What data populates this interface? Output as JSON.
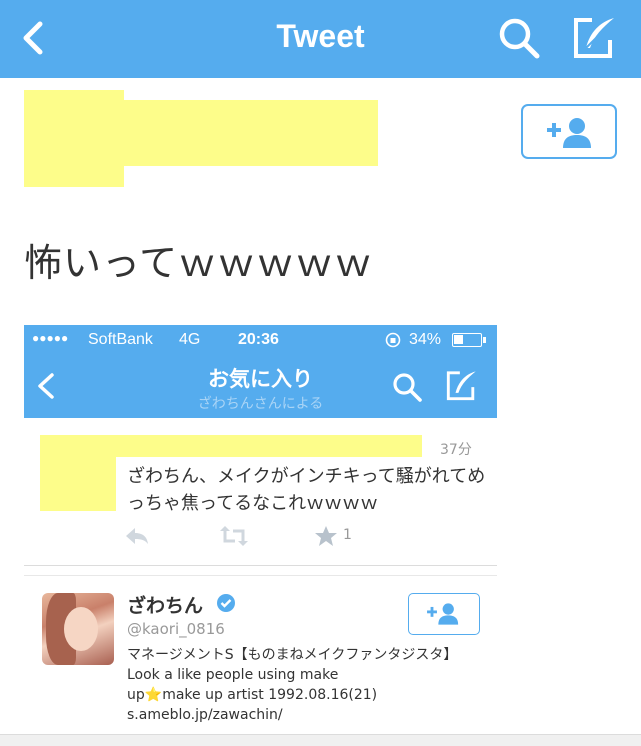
{
  "header": {
    "title": "Tweet",
    "back_icon": "chevron-left-icon",
    "search_icon": "search-icon",
    "compose_icon": "compose-icon"
  },
  "tweet": {
    "text": "怖いってｗｗｗｗｗ",
    "follow_icon": "add-user-icon"
  },
  "embedded": {
    "status_bar": {
      "signal": "●●●●●",
      "carrier": "SoftBank",
      "network": "4G",
      "time": "20:36",
      "battery": "34%"
    },
    "nav": {
      "title": "お気に入り",
      "subtitle": "ざわちんさんによる"
    },
    "tweet": {
      "time": "37分",
      "text": "ざわちん、メイクがインチキって騒がれてめっちゃ焦ってるなこれｗｗｗｗ",
      "favorite_count": "1"
    },
    "profile": {
      "name": "ざわちん",
      "handle": "@kaori_0816",
      "bio_line1": "マネージメントS【ものまねメイクファンタジスタ】 Look a like people using make",
      "bio_line2": "up⭐make up artist 1992.08.16(21)",
      "bio_line3": "s.ameblo.jp/zawachin/"
    }
  },
  "colors": {
    "accent": "#55acee",
    "redaction": "#fdfd8a"
  }
}
